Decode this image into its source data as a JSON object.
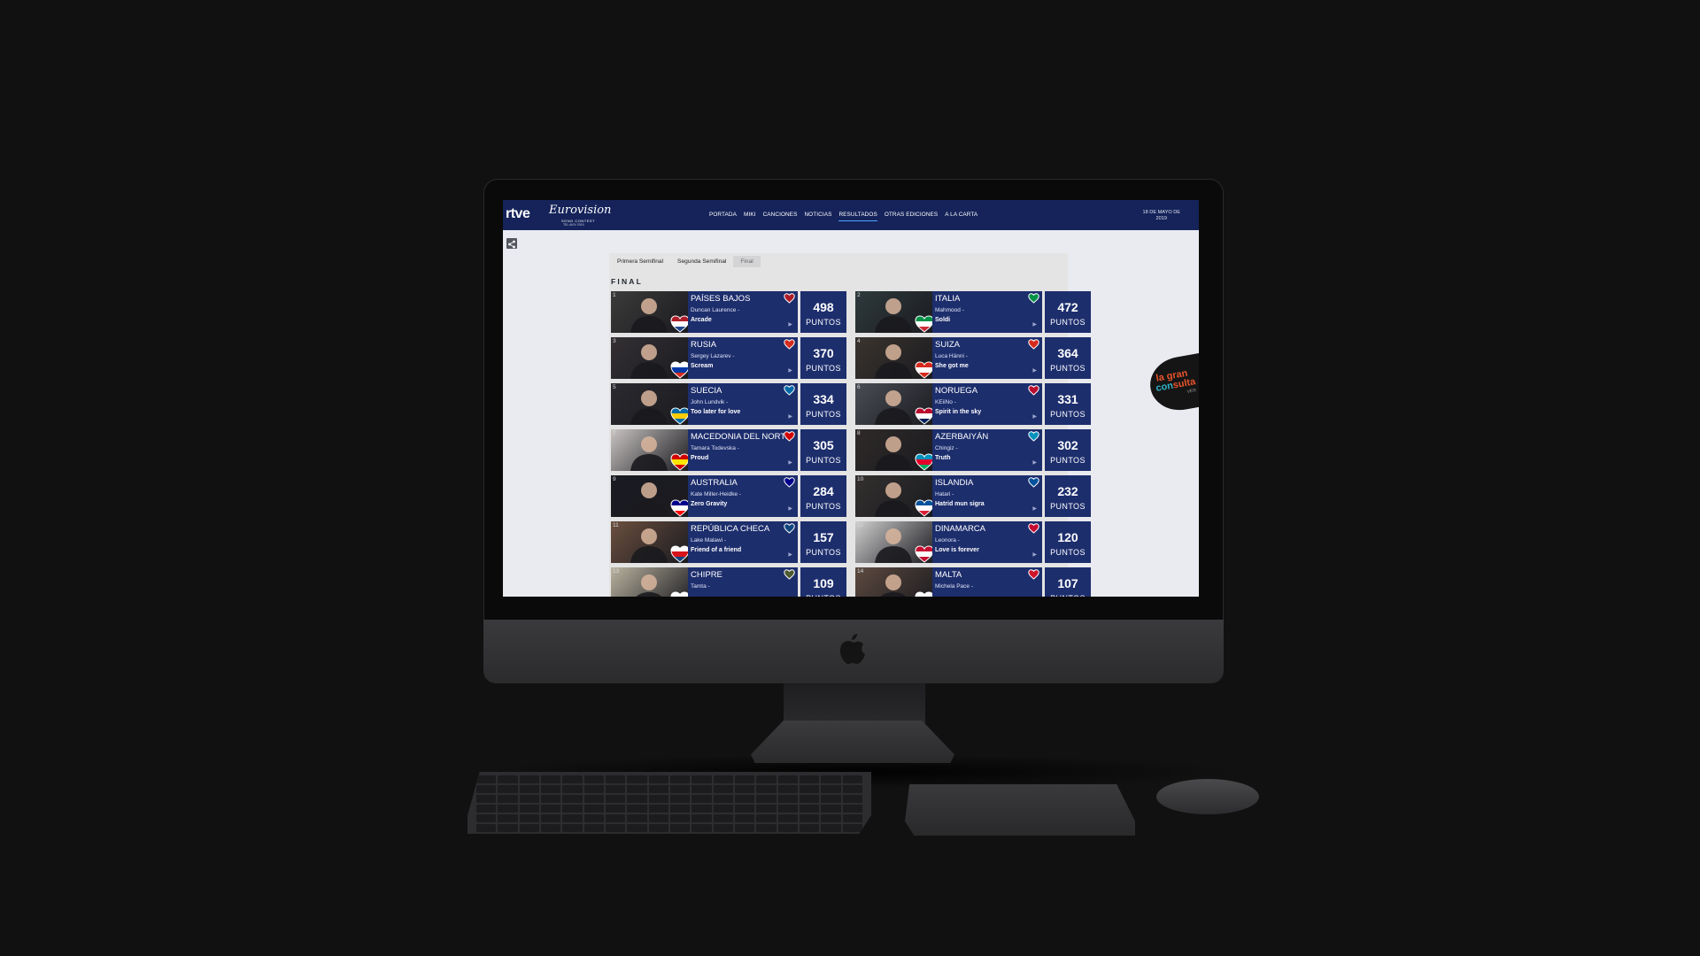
{
  "site": {
    "broadcaster_logo": "rtve",
    "event_logo": {
      "title": "Eurovision",
      "subtitle": "SONG CONTEST",
      "location": "TEL AVIV 2019"
    },
    "nav": [
      {
        "label": "PORTADA",
        "active": false
      },
      {
        "label": "MIKI",
        "active": false
      },
      {
        "label": "CANCIONES",
        "active": false
      },
      {
        "label": "NOTICIAS",
        "active": false
      },
      {
        "label": "RESULTADOS",
        "active": true
      },
      {
        "label": "OTRAS EDICIONES",
        "active": false
      },
      {
        "label": "A LA CARTA",
        "active": false
      }
    ],
    "date_line1": "18 DE MAYO DE",
    "date_line2": "2019",
    "share_icon": "share-icon"
  },
  "tabs": [
    {
      "label": "Primera Semifinal",
      "active": false
    },
    {
      "label": "Segunda Semifinal",
      "active": false
    },
    {
      "label": "Final",
      "active": true
    }
  ],
  "section_title": "FINAL",
  "points_label": "PUNTOS",
  "results": [
    {
      "rank": "1",
      "country": "PAÍSES BAJOS",
      "artist": "Duncan Laurence -",
      "song": "Arcade",
      "points": "498",
      "flag": "netherlands-flag-heart-icon",
      "colors": [
        "#ae1c28",
        "#ffffff",
        "#21468b"
      ]
    },
    {
      "rank": "2",
      "country": "ITALIA",
      "artist": "Mahmood -",
      "song": "Soldi",
      "points": "472",
      "flag": "italy-flag-heart-icon",
      "colors": [
        "#009246",
        "#ffffff",
        "#ce2b37"
      ]
    },
    {
      "rank": "3",
      "country": "RUSIA",
      "artist": "Sergey Lazarev -",
      "song": "Scream",
      "points": "370",
      "flag": "russia-flag-heart-icon",
      "colors": [
        "#ffffff",
        "#0039a6",
        "#d52b1e"
      ]
    },
    {
      "rank": "4",
      "country": "SUIZA",
      "artist": "Luca Hänni -",
      "song": "She got me",
      "points": "364",
      "flag": "switzerland-flag-heart-icon",
      "colors": [
        "#d52b1e",
        "#ffffff",
        "#d52b1e"
      ]
    },
    {
      "rank": "5",
      "country": "SUECIA",
      "artist": "John Lundvik -",
      "song": "Too later for love",
      "points": "334",
      "flag": "sweden-flag-heart-icon",
      "colors": [
        "#006aa7",
        "#fecc00",
        "#006aa7"
      ]
    },
    {
      "rank": "6",
      "country": "NORUEGA",
      "artist": "KEiiNo -",
      "song": "Spirit in the sky",
      "points": "331",
      "flag": "norway-flag-heart-icon",
      "colors": [
        "#ba0c2f",
        "#ffffff",
        "#00205b"
      ]
    },
    {
      "rank": "7",
      "country": "MACEDONIA DEL NORTE",
      "artist": "Tamara Todevska -",
      "song": "Proud",
      "points": "305",
      "flag": "north-macedonia-flag-heart-icon",
      "colors": [
        "#d20000",
        "#ffe600",
        "#d20000"
      ]
    },
    {
      "rank": "8",
      "country": "AZERBAIYÁN",
      "artist": "Chingiz -",
      "song": "Truth",
      "points": "302",
      "flag": "azerbaijan-flag-heart-icon",
      "colors": [
        "#0092bc",
        "#e4002b",
        "#00af66"
      ]
    },
    {
      "rank": "9",
      "country": "AUSTRALIA",
      "artist": "Kate Miller-Heidke -",
      "song": "Zero Gravity",
      "points": "284",
      "flag": "australia-flag-heart-icon",
      "colors": [
        "#00008b",
        "#ffffff",
        "#ff0000"
      ]
    },
    {
      "rank": "10",
      "country": "ISLANDIA",
      "artist": "Hatari -",
      "song": "Hatrid mun sigra",
      "points": "232",
      "flag": "iceland-flag-heart-icon",
      "colors": [
        "#02529c",
        "#ffffff",
        "#dc1e35"
      ]
    },
    {
      "rank": "11",
      "country": "REPÚBLICA CHECA",
      "artist": "Lake Malawi -",
      "song": "Friend of a friend",
      "points": "157",
      "flag": "czech-flag-heart-icon",
      "colors": [
        "#ffffff",
        "#d7141a",
        "#11457e"
      ]
    },
    {
      "rank": "12",
      "country": "DINAMARCA",
      "artist": "Leonora -",
      "song": "Love is forever",
      "points": "120",
      "flag": "denmark-flag-heart-icon",
      "colors": [
        "#c60c30",
        "#ffffff",
        "#c60c30"
      ]
    },
    {
      "rank": "13",
      "country": "CHIPRE",
      "artist": "Tamta -",
      "song": "",
      "points": "109",
      "flag": "cyprus-flag-heart-icon",
      "colors": [
        "#ffffff",
        "#d57800",
        "#4e5b31"
      ]
    },
    {
      "rank": "14",
      "country": "MALTA",
      "artist": "Michela Pace -",
      "song": "",
      "points": "107",
      "flag": "malta-flag-heart-icon",
      "colors": [
        "#ffffff",
        "#cf142b",
        "#cf142b"
      ]
    }
  ],
  "consulta_badge": {
    "line1": "la gran",
    "line2a": "con",
    "line2b": "sulta",
    "line3": "VER"
  },
  "theme": {
    "navy": "#15235a",
    "card": "#1d2e6d",
    "page_bg": "#e9ebf0",
    "accent": "#4da3ff"
  }
}
